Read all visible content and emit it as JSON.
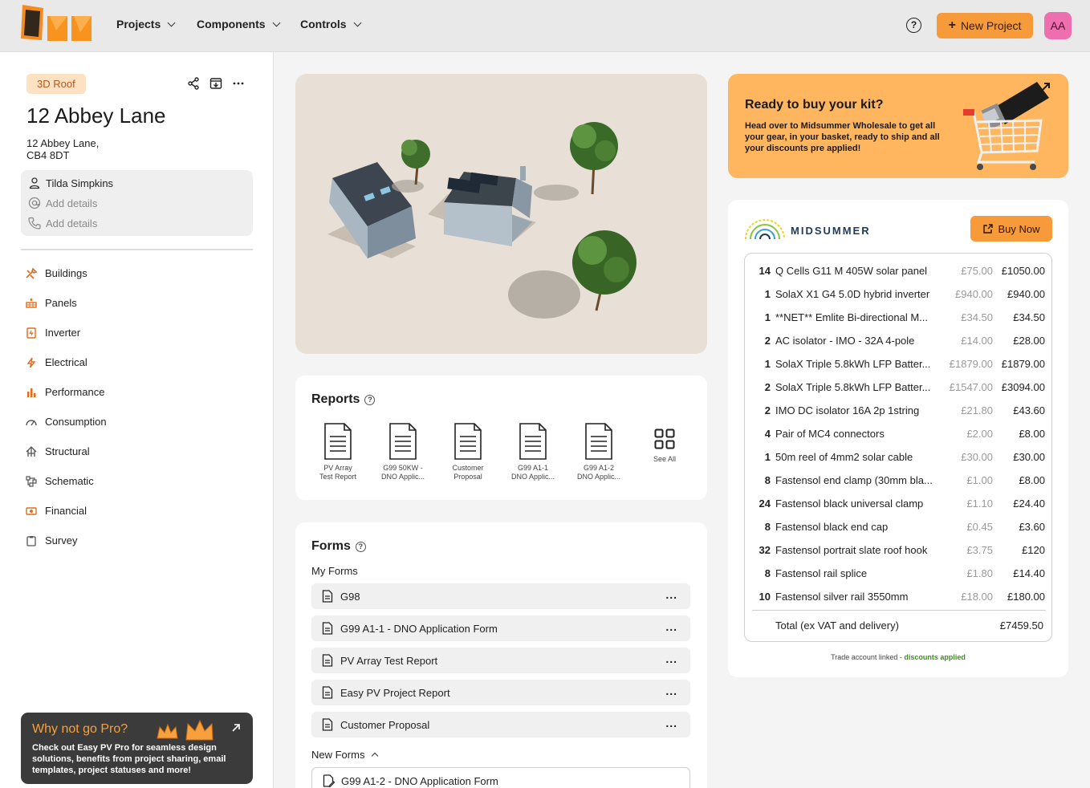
{
  "nav": {
    "items": [
      "Projects",
      "Components",
      "Controls"
    ],
    "help_label": "?",
    "new_project_label": "New Project",
    "avatar_initials": "AA"
  },
  "project": {
    "badge": "3D Roof",
    "title": "12 Abbey Lane",
    "address_line1": "12 Abbey Lane,",
    "address_line2": "CB4 8DT",
    "contact_name": "Tilda Simpkins",
    "email_placeholder": "Add details",
    "phone_placeholder": "Add details"
  },
  "sidebar": {
    "items": [
      {
        "label": "Buildings",
        "icon": "tools-icon"
      },
      {
        "label": "Panels",
        "icon": "solar-panel-icon"
      },
      {
        "label": "Inverter",
        "icon": "inverter-icon"
      },
      {
        "label": "Electrical",
        "icon": "lightning-icon"
      },
      {
        "label": "Performance",
        "icon": "bar-chart-icon"
      },
      {
        "label": "Consumption",
        "icon": "gauge-icon"
      },
      {
        "label": "Structural",
        "icon": "structure-icon"
      },
      {
        "label": "Schematic",
        "icon": "schematic-icon"
      },
      {
        "label": "Financial",
        "icon": "money-icon"
      },
      {
        "label": "Survey",
        "icon": "clipboard-icon"
      }
    ]
  },
  "pro": {
    "title": "Why not go Pro?",
    "text": "Check out Easy PV Pro for seamless design solutions, benefits from project sharing, email templates, project statuses and more!"
  },
  "reports": {
    "title": "Reports",
    "items": [
      {
        "line1": "PV Array",
        "line2": "Test Report"
      },
      {
        "line1": "G99 50KW -",
        "line2": "DNO Applic..."
      },
      {
        "line1": "Customer",
        "line2": "Proposal"
      },
      {
        "line1": "G99 A1-1",
        "line2": "DNO Applic..."
      },
      {
        "line1": "G99 A1-2",
        "line2": "DNO Applic..."
      }
    ],
    "see_all_label": "See All"
  },
  "forms": {
    "title": "Forms",
    "my_forms_label": "My Forms",
    "my_forms": [
      "G98",
      "G99 A1-1 - DNO Application Form",
      "PV Array Test Report",
      "Easy PV Project Report",
      "Customer Proposal"
    ],
    "more_label": "...",
    "new_forms_label": "New Forms",
    "new_forms": [
      "G99 A1-2 - DNO Application Form"
    ]
  },
  "kit": {
    "title": "Ready to buy your kit?",
    "text": "Head over to Midsummer Wholesale to get all your gear, in your basket, ready to ship and all your discounts pre applied!"
  },
  "basket": {
    "brand": "MIDSUMMER",
    "buy_now_label": "Buy Now",
    "lines": [
      {
        "qty": "14",
        "name": "Q Cells G11 M 405W solar panel",
        "unit": "£75.00",
        "total": "£1050.00"
      },
      {
        "qty": "1",
        "name": "SolaX X1 G4 5.0D hybrid inverter",
        "unit": "£940.00",
        "total": "£940.00"
      },
      {
        "qty": "1",
        "name": "**NET** Emlite Bi-directional M...",
        "unit": "£34.50",
        "total": "£34.50"
      },
      {
        "qty": "2",
        "name": "AC isolator - IMO - 32A 4-pole",
        "unit": "£14.00",
        "total": "£28.00"
      },
      {
        "qty": "1",
        "name": "SolaX Triple 5.8kWh LFP Batter...",
        "unit": "£1879.00",
        "total": "£1879.00"
      },
      {
        "qty": "2",
        "name": "SolaX Triple 5.8kWh LFP Batter...",
        "unit": "£1547.00",
        "total": "£3094.00"
      },
      {
        "qty": "2",
        "name": "IMO DC isolator 16A 2p 1string",
        "unit": "£21.80",
        "total": "£43.60"
      },
      {
        "qty": "4",
        "name": "Pair of MC4 connectors",
        "unit": "£2.00",
        "total": "£8.00"
      },
      {
        "qty": "1",
        "name": "50m reel of 4mm2 solar cable",
        "unit": "£30.00",
        "total": "£30.00"
      },
      {
        "qty": "8",
        "name": "Fastensol end clamp (30mm bla...",
        "unit": "£1.00",
        "total": "£8.00"
      },
      {
        "qty": "24",
        "name": "Fastensol black universal clamp",
        "unit": "£1.10",
        "total": "£24.40"
      },
      {
        "qty": "8",
        "name": "Fastensol black end cap",
        "unit": "£0.45",
        "total": "£3.60"
      },
      {
        "qty": "32",
        "name": "Fastensol portrait slate roof hook",
        "unit": "£3.75",
        "total": "£120"
      },
      {
        "qty": "8",
        "name": "Fastensol rail splice",
        "unit": "£1.80",
        "total": "£14.40"
      },
      {
        "qty": "10",
        "name": "Fastensol silver rail 3550mm",
        "unit": "£18.00",
        "total": "£180.00"
      }
    ],
    "total_label": "Total (ex VAT and delivery)",
    "total_value": "£7459.50",
    "trade_note": "Trade account linked - ",
    "trade_note_highlight": "discounts applied"
  },
  "colors": {
    "accent": "#f69a3a",
    "kit_background": "#ffb65e",
    "badge_background": "#fde1c3",
    "avatar": "#ee6fb0",
    "discount_green": "#3e8e1e"
  }
}
